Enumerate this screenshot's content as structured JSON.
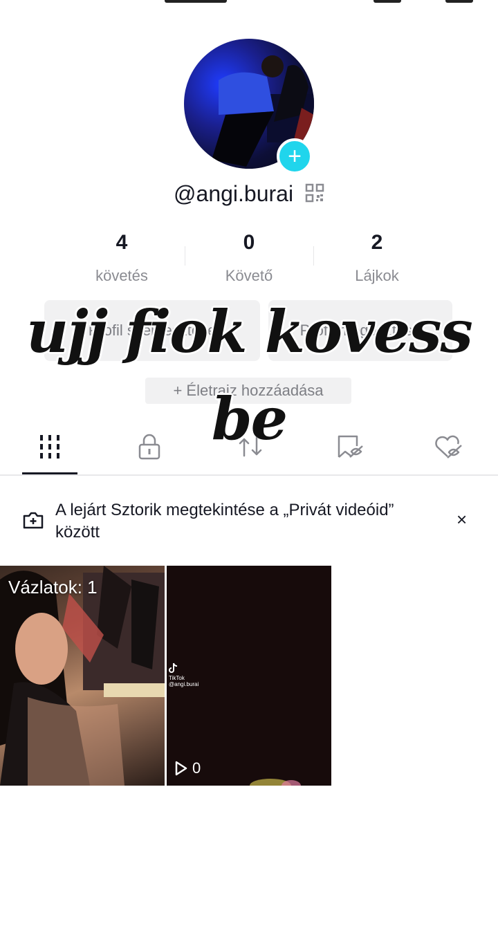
{
  "profile": {
    "username": "@angi.burai",
    "stats": [
      {
        "value": "4",
        "label": "követés"
      },
      {
        "value": "0",
        "label": "Követő"
      },
      {
        "value": "2",
        "label": "Lájkok"
      }
    ],
    "buttons": {
      "edit_profile": "Profil szerkesztése",
      "share_profile": "Profil megosztása"
    },
    "bio_add": "+ Életrajz hozzáadása"
  },
  "overlay_text": {
    "line1": "ujj fiok kovess",
    "line2": "be"
  },
  "tabs": [
    {
      "icon": "videos-grid-icon",
      "active": true
    },
    {
      "icon": "lock-icon",
      "active": false
    },
    {
      "icon": "repost-icon",
      "active": false
    },
    {
      "icon": "favorites-icon",
      "active": false
    },
    {
      "icon": "liked-hidden-icon",
      "active": false
    }
  ],
  "banner": {
    "icon": "camera-plus-icon",
    "text": "A lejárt Sztorik megtekintése a „Privát videóid” között",
    "close": "×"
  },
  "videos": [
    {
      "overlay_label": "Vázlatok: 1"
    },
    {
      "watermark_brand": "TikTok",
      "watermark_user": "@angi.burai",
      "views": "0"
    }
  ],
  "colors": {
    "accent": "#20d5ec",
    "text": "#161823",
    "secondary_text": "#8a8b91",
    "button_bg": "#f1f1f2"
  }
}
